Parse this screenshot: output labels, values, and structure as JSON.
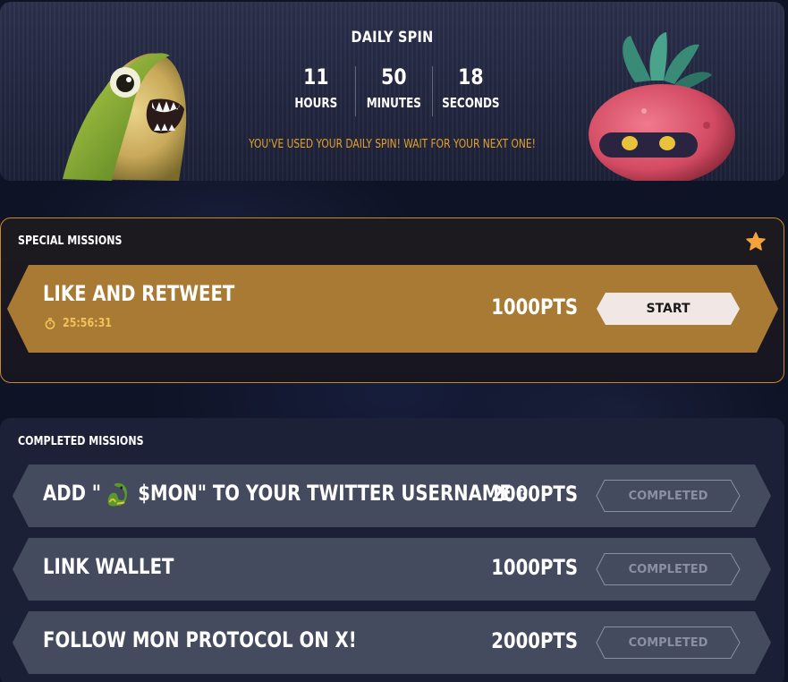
{
  "daily_spin": {
    "title": "DAILY SPIN",
    "hours_value": "11",
    "hours_label": "HOURS",
    "minutes_value": "50",
    "minutes_label": "MINUTES",
    "seconds_value": "18",
    "seconds_label": "SECONDS",
    "message": "YOU'VE USED YOUR DAILY SPIN! WAIT FOR YOUR NEXT ONE!"
  },
  "special_missions": {
    "heading": "SPECIAL MISSIONS",
    "items": [
      {
        "title": "LIKE AND RETWEET",
        "timer": "25:56:31",
        "points": "1000PTS",
        "action": "START"
      }
    ]
  },
  "completed_missions": {
    "heading": "COMPLETED MISSIONS",
    "items": [
      {
        "title_prefix": "ADD \"",
        "title_suffix": " $MON\" TO YOUR TWITTER USERNAME",
        "points": "2000PTS",
        "status": "COMPLETED"
      },
      {
        "title": "LINK WALLET",
        "points": "1000PTS",
        "status": "COMPLETED"
      },
      {
        "title": "FOLLOW MON PROTOCOL ON X!",
        "points": "2000PTS",
        "status": "COMPLETED"
      }
    ]
  },
  "colors": {
    "accent_gold": "#a97a34",
    "timer_gold": "#f3c25a",
    "message_orange": "#e3a12a",
    "completed_card": "#454b5e"
  },
  "icons": [
    "stopwatch-icon",
    "star-icon",
    "external-link-icon",
    "dragon-emoji-icon"
  ]
}
